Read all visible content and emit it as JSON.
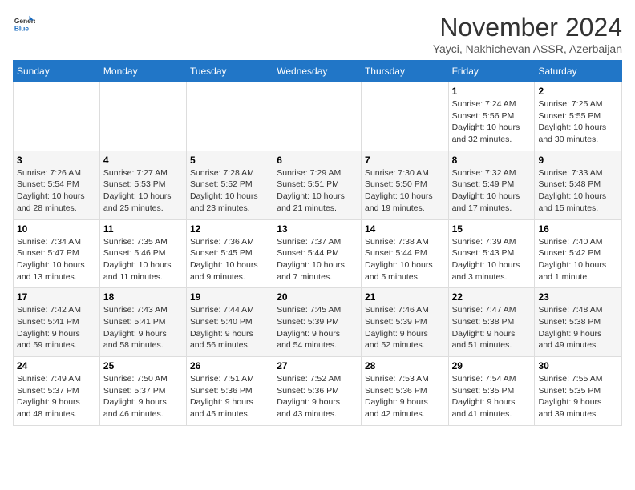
{
  "logo": {
    "line1": "General",
    "line2": "Blue"
  },
  "title": "November 2024",
  "subtitle": "Yayci, Nakhichevan ASSR, Azerbaijan",
  "weekdays": [
    "Sunday",
    "Monday",
    "Tuesday",
    "Wednesday",
    "Thursday",
    "Friday",
    "Saturday"
  ],
  "weeks": [
    [
      {
        "day": "",
        "info": ""
      },
      {
        "day": "",
        "info": ""
      },
      {
        "day": "",
        "info": ""
      },
      {
        "day": "",
        "info": ""
      },
      {
        "day": "",
        "info": ""
      },
      {
        "day": "1",
        "info": "Sunrise: 7:24 AM\nSunset: 5:56 PM\nDaylight: 10 hours\nand 32 minutes."
      },
      {
        "day": "2",
        "info": "Sunrise: 7:25 AM\nSunset: 5:55 PM\nDaylight: 10 hours\nand 30 minutes."
      }
    ],
    [
      {
        "day": "3",
        "info": "Sunrise: 7:26 AM\nSunset: 5:54 PM\nDaylight: 10 hours\nand 28 minutes."
      },
      {
        "day": "4",
        "info": "Sunrise: 7:27 AM\nSunset: 5:53 PM\nDaylight: 10 hours\nand 25 minutes."
      },
      {
        "day": "5",
        "info": "Sunrise: 7:28 AM\nSunset: 5:52 PM\nDaylight: 10 hours\nand 23 minutes."
      },
      {
        "day": "6",
        "info": "Sunrise: 7:29 AM\nSunset: 5:51 PM\nDaylight: 10 hours\nand 21 minutes."
      },
      {
        "day": "7",
        "info": "Sunrise: 7:30 AM\nSunset: 5:50 PM\nDaylight: 10 hours\nand 19 minutes."
      },
      {
        "day": "8",
        "info": "Sunrise: 7:32 AM\nSunset: 5:49 PM\nDaylight: 10 hours\nand 17 minutes."
      },
      {
        "day": "9",
        "info": "Sunrise: 7:33 AM\nSunset: 5:48 PM\nDaylight: 10 hours\nand 15 minutes."
      }
    ],
    [
      {
        "day": "10",
        "info": "Sunrise: 7:34 AM\nSunset: 5:47 PM\nDaylight: 10 hours\nand 13 minutes."
      },
      {
        "day": "11",
        "info": "Sunrise: 7:35 AM\nSunset: 5:46 PM\nDaylight: 10 hours\nand 11 minutes."
      },
      {
        "day": "12",
        "info": "Sunrise: 7:36 AM\nSunset: 5:45 PM\nDaylight: 10 hours\nand 9 minutes."
      },
      {
        "day": "13",
        "info": "Sunrise: 7:37 AM\nSunset: 5:44 PM\nDaylight: 10 hours\nand 7 minutes."
      },
      {
        "day": "14",
        "info": "Sunrise: 7:38 AM\nSunset: 5:44 PM\nDaylight: 10 hours\nand 5 minutes."
      },
      {
        "day": "15",
        "info": "Sunrise: 7:39 AM\nSunset: 5:43 PM\nDaylight: 10 hours\nand 3 minutes."
      },
      {
        "day": "16",
        "info": "Sunrise: 7:40 AM\nSunset: 5:42 PM\nDaylight: 10 hours\nand 1 minute."
      }
    ],
    [
      {
        "day": "17",
        "info": "Sunrise: 7:42 AM\nSunset: 5:41 PM\nDaylight: 9 hours\nand 59 minutes."
      },
      {
        "day": "18",
        "info": "Sunrise: 7:43 AM\nSunset: 5:41 PM\nDaylight: 9 hours\nand 58 minutes."
      },
      {
        "day": "19",
        "info": "Sunrise: 7:44 AM\nSunset: 5:40 PM\nDaylight: 9 hours\nand 56 minutes."
      },
      {
        "day": "20",
        "info": "Sunrise: 7:45 AM\nSunset: 5:39 PM\nDaylight: 9 hours\nand 54 minutes."
      },
      {
        "day": "21",
        "info": "Sunrise: 7:46 AM\nSunset: 5:39 PM\nDaylight: 9 hours\nand 52 minutes."
      },
      {
        "day": "22",
        "info": "Sunrise: 7:47 AM\nSunset: 5:38 PM\nDaylight: 9 hours\nand 51 minutes."
      },
      {
        "day": "23",
        "info": "Sunrise: 7:48 AM\nSunset: 5:38 PM\nDaylight: 9 hours\nand 49 minutes."
      }
    ],
    [
      {
        "day": "24",
        "info": "Sunrise: 7:49 AM\nSunset: 5:37 PM\nDaylight: 9 hours\nand 48 minutes."
      },
      {
        "day": "25",
        "info": "Sunrise: 7:50 AM\nSunset: 5:37 PM\nDaylight: 9 hours\nand 46 minutes."
      },
      {
        "day": "26",
        "info": "Sunrise: 7:51 AM\nSunset: 5:36 PM\nDaylight: 9 hours\nand 45 minutes."
      },
      {
        "day": "27",
        "info": "Sunrise: 7:52 AM\nSunset: 5:36 PM\nDaylight: 9 hours\nand 43 minutes."
      },
      {
        "day": "28",
        "info": "Sunrise: 7:53 AM\nSunset: 5:36 PM\nDaylight: 9 hours\nand 42 minutes."
      },
      {
        "day": "29",
        "info": "Sunrise: 7:54 AM\nSunset: 5:35 PM\nDaylight: 9 hours\nand 41 minutes."
      },
      {
        "day": "30",
        "info": "Sunrise: 7:55 AM\nSunset: 5:35 PM\nDaylight: 9 hours\nand 39 minutes."
      }
    ]
  ]
}
